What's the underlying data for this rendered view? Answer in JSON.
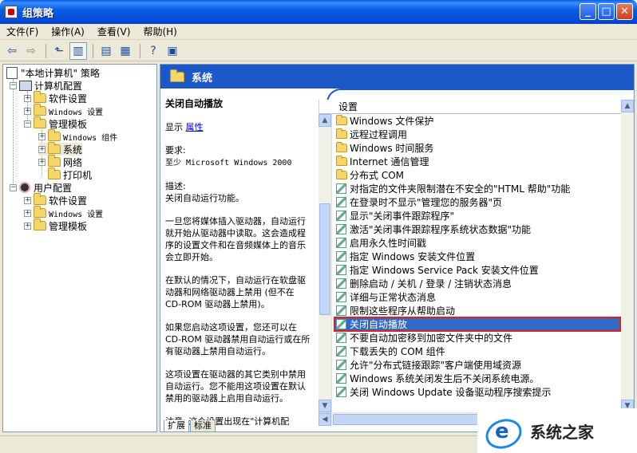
{
  "window": {
    "title": "组策略"
  },
  "menu": [
    "文件(F)",
    "操作(A)",
    "查看(V)",
    "帮助(H)"
  ],
  "tree": {
    "root": "\"本地计算机\" 策略",
    "computer_config": "计算机配置",
    "software_settings": "软件设置",
    "windows_settings": "Windows 设置",
    "admin_templates": "管理模板",
    "windows_components": "Windows 组件",
    "system": "系统",
    "network": "网络",
    "printers": "打印机",
    "user_config": "用户配置",
    "user_software_settings": "软件设置",
    "user_windows_settings": "Windows 设置",
    "user_admin_templates": "管理模板"
  },
  "header": {
    "title": "系统"
  },
  "description": {
    "title": "关闭自动播放",
    "display_label": "显示",
    "display_link": "属性",
    "requires_label": "要求:",
    "requires_value": "至少 Microsoft Windows 2000",
    "desc_label": "描述:",
    "desc_value": "关闭自动运行功能。",
    "para1": "一旦您将媒体插入驱动器，自动运行就开始从驱动器中读取。这会造成程序的设置文件和在音频媒体上的音乐会立即开始。",
    "para2": "在默认的情况下，自动运行在软盘驱动器和网络驱动器上禁用 (但不在 CD-ROM 驱动器上禁用)。",
    "para3": "如果您启动这项设置，您还可以在 CD-ROM 驱动器禁用自动运行或在所有驱动器上禁用自动运行。",
    "para4": "这项设置在驱动器的其它类别中禁用自动运行。您不能用这项设置在默认禁用的驱动器上启用自动运行。",
    "para5": "注意: 这个设置出现在\"计算机配"
  },
  "tabs": [
    "扩展",
    "标准"
  ],
  "list_header": "设置",
  "settings": [
    {
      "label": "Windows 文件保护",
      "type": "folder"
    },
    {
      "label": "远程过程调用",
      "type": "folder"
    },
    {
      "label": "Windows 时间服务",
      "type": "folder"
    },
    {
      "label": "Internet 通信管理",
      "type": "folder"
    },
    {
      "label": "分布式 COM",
      "type": "folder"
    },
    {
      "label": "对指定的文件夹限制潜在不安全的\"HTML 帮助\"功能",
      "type": "setting"
    },
    {
      "label": "在登录时不显示\"管理您的服务器\"页",
      "type": "setting"
    },
    {
      "label": "显示\"关闭事件跟踪程序\"",
      "type": "setting"
    },
    {
      "label": "激活\"关闭事件跟踪程序系统状态数据\"功能",
      "type": "setting"
    },
    {
      "label": "启用永久性时间戳",
      "type": "setting"
    },
    {
      "label": "指定 Windows 安装文件位置",
      "type": "setting"
    },
    {
      "label": "指定 Windows Service Pack 安装文件位置",
      "type": "setting"
    },
    {
      "label": "删除启动 / 关机 / 登录 / 注销状态消息",
      "type": "setting"
    },
    {
      "label": "详细与正常状态消息",
      "type": "setting"
    },
    {
      "label": "限制这些程序从帮助启动",
      "type": "setting"
    },
    {
      "label": "关闭自动播放",
      "type": "setting",
      "selected": true
    },
    {
      "label": "不要自动加密移到加密文件夹中的文件",
      "type": "setting"
    },
    {
      "label": "下载丢失的 COM 组件",
      "type": "setting"
    },
    {
      "label": "允许\"分布式链接跟踪\"客户端使用域资源",
      "type": "setting"
    },
    {
      "label": "Windows 系统关闭发生后不关闭系统电源。",
      "type": "setting"
    },
    {
      "label": "关闭 Windows Update 设备驱动程序搜索提示",
      "type": "setting"
    }
  ],
  "watermark": {
    "text": "系统之家"
  },
  "colors": {
    "titlebar": "#0a5ee6",
    "header_band": "#1c58c8",
    "selection": "#316ac5",
    "highlight_border": "#dd2222"
  }
}
